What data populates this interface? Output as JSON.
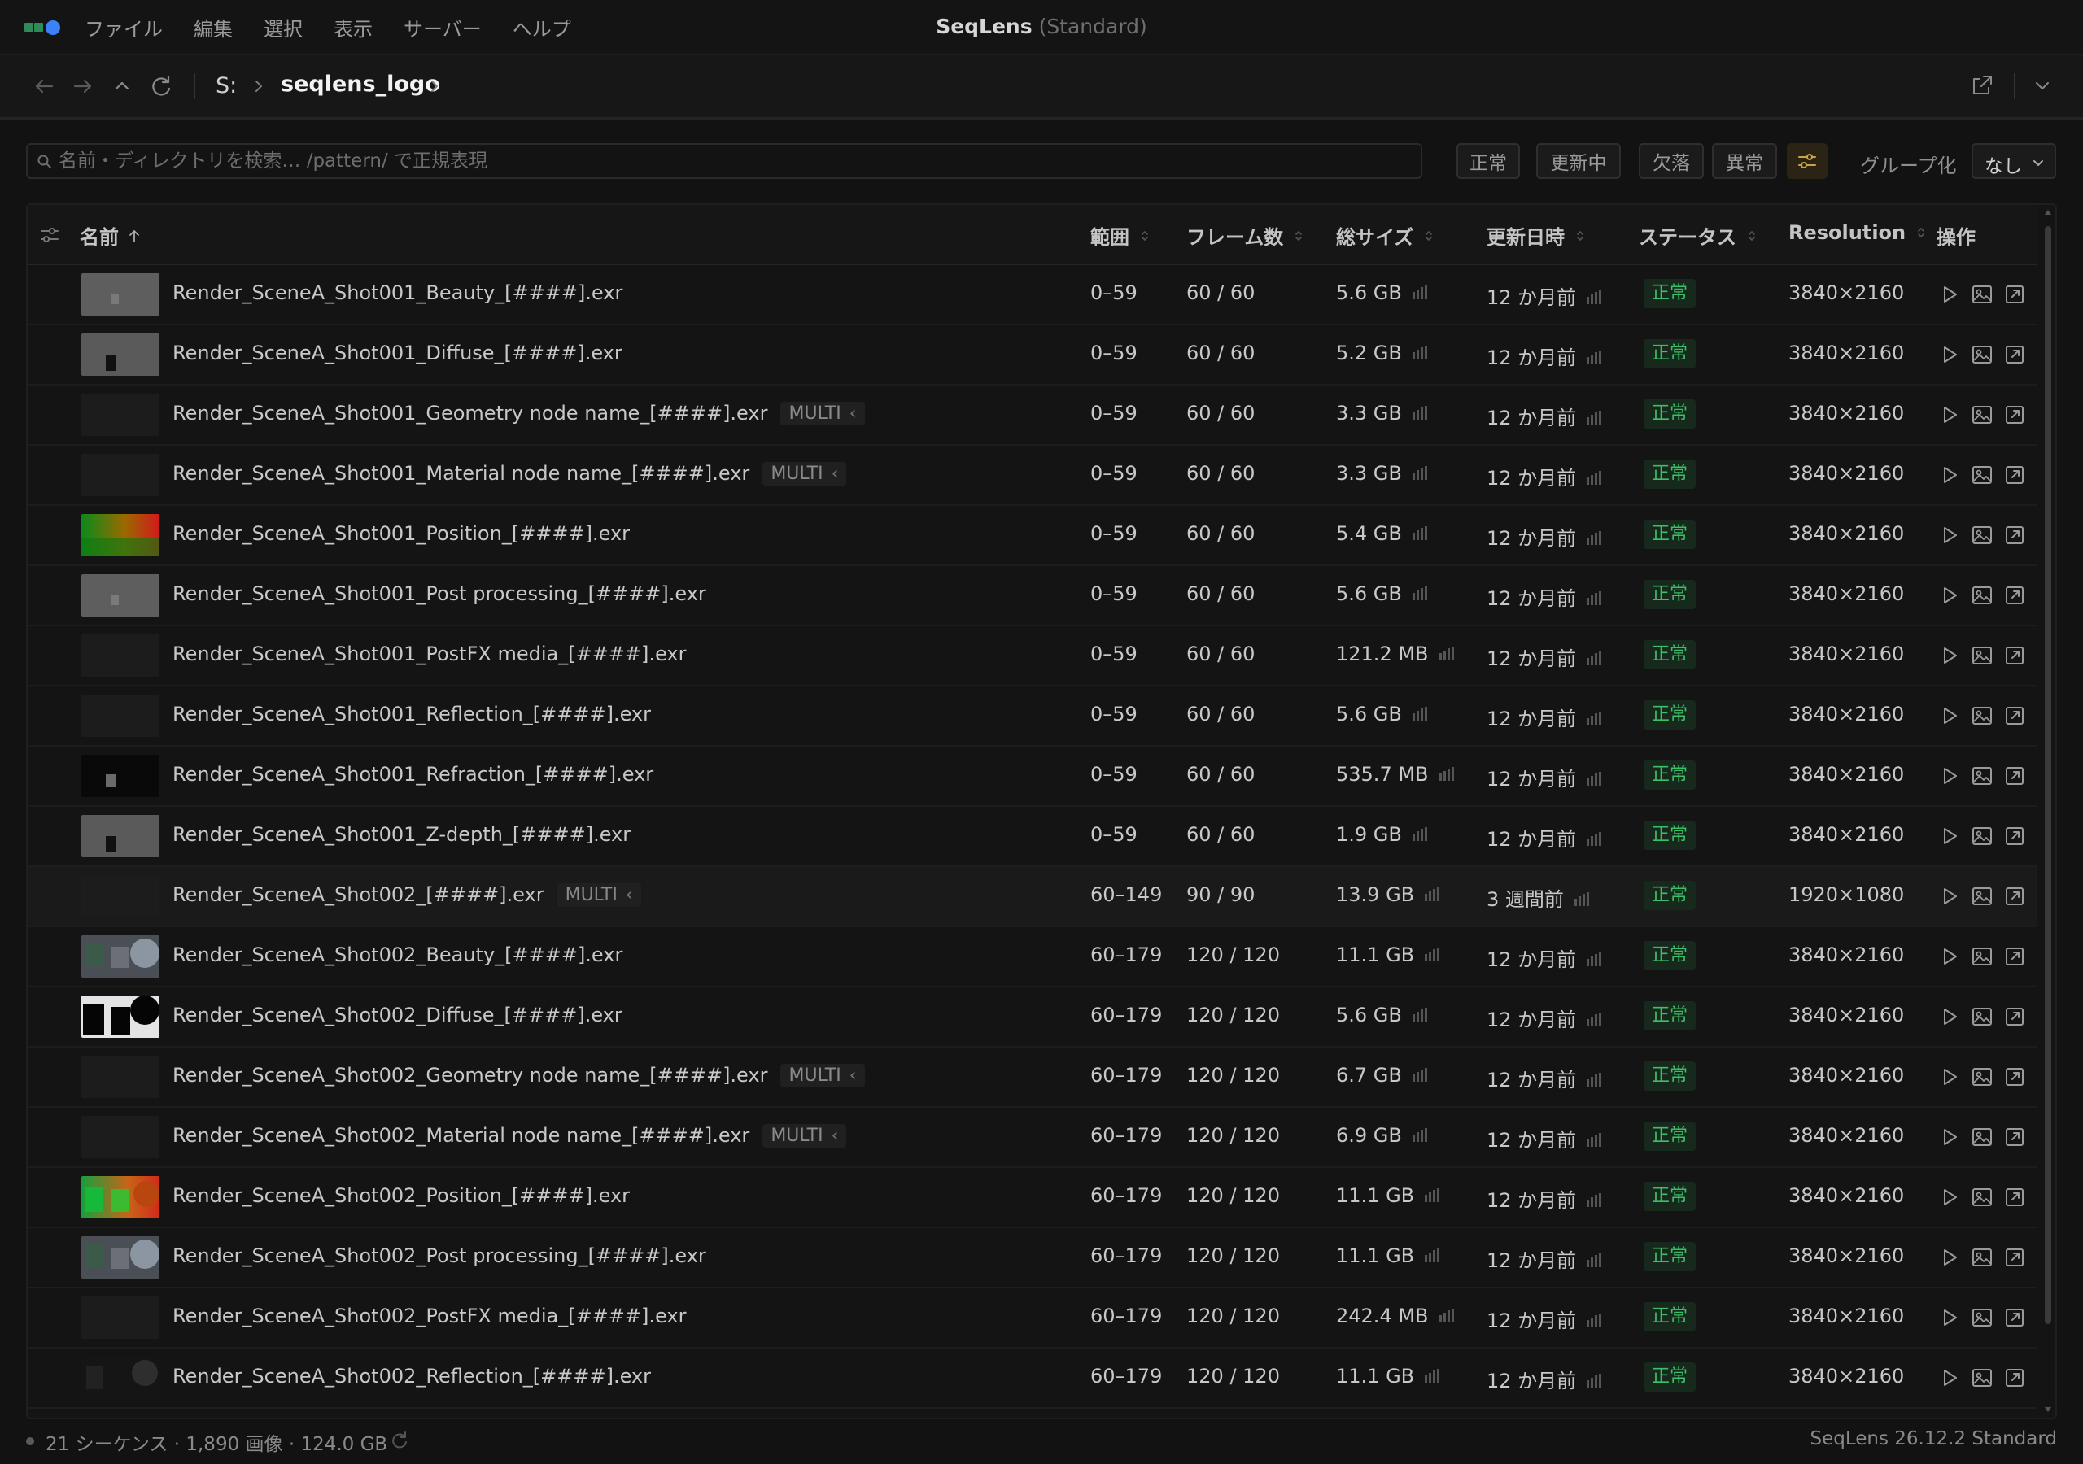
{
  "app": {
    "name": "SeqLens",
    "edition": "(Standard)"
  },
  "menu": [
    "ファイル",
    "編集",
    "選択",
    "表示",
    "サーバー",
    "ヘルプ"
  ],
  "path": {
    "drive": "S:",
    "folder": "seqlens_logo"
  },
  "search": {
    "placeholder": "名前・ディレクトリを検索… /pattern/ で正規表現",
    "value": ""
  },
  "filters": {
    "chips": [
      "正常",
      "更新中",
      "欠落",
      "異常"
    ],
    "group_label": "グループ化",
    "group_value": "なし"
  },
  "columns": {
    "name": "名前",
    "range": "範囲",
    "frames": "フレーム数",
    "size": "総サイズ",
    "modified": "更新日時",
    "status": "ステータス",
    "resolution": "Resolution",
    "actions": "操作"
  },
  "sort": {
    "column": "名前",
    "direction": "asc"
  },
  "rows": [
    {
      "name": "Render_SceneA_Shot001_Beauty_[####].exr",
      "badge": "",
      "range": "0–59",
      "frames": "60 / 60",
      "size": "5.6 GB",
      "modified": "12 か月前",
      "status": "正常",
      "resolution": "3840×2160",
      "thumb": "gray-object"
    },
    {
      "name": "Render_SceneA_Shot001_Diffuse_[####].exr",
      "badge": "",
      "range": "0–59",
      "frames": "60 / 60",
      "size": "5.2 GB",
      "modified": "12 か月前",
      "status": "正常",
      "resolution": "3840×2160",
      "thumb": "gray-block"
    },
    {
      "name": "Render_SceneA_Shot001_Geometry node name_[####].exr",
      "badge": "MULTI",
      "range": "0–59",
      "frames": "60 / 60",
      "size": "3.3 GB",
      "modified": "12 か月前",
      "status": "正常",
      "resolution": "3840×2160",
      "thumb": "dark"
    },
    {
      "name": "Render_SceneA_Shot001_Material node name_[####].exr",
      "badge": "MULTI",
      "range": "0–59",
      "frames": "60 / 60",
      "size": "3.3 GB",
      "modified": "12 か月前",
      "status": "正常",
      "resolution": "3840×2160",
      "thumb": "dark"
    },
    {
      "name": "Render_SceneA_Shot001_Position_[####].exr",
      "badge": "",
      "range": "0–59",
      "frames": "60 / 60",
      "size": "5.4 GB",
      "modified": "12 か月前",
      "status": "正常",
      "resolution": "3840×2160",
      "thumb": "position"
    },
    {
      "name": "Render_SceneA_Shot001_Post processing_[####].exr",
      "badge": "",
      "range": "0–59",
      "frames": "60 / 60",
      "size": "5.6 GB",
      "modified": "12 か月前",
      "status": "正常",
      "resolution": "3840×2160",
      "thumb": "gray-object"
    },
    {
      "name": "Render_SceneA_Shot001_PostFX media_[####].exr",
      "badge": "",
      "range": "0–59",
      "frames": "60 / 60",
      "size": "121.2 MB",
      "modified": "12 か月前",
      "status": "正常",
      "resolution": "3840×2160",
      "thumb": "dark"
    },
    {
      "name": "Render_SceneA_Shot001_Reflection_[####].exr",
      "badge": "",
      "range": "0–59",
      "frames": "60 / 60",
      "size": "5.6 GB",
      "modified": "12 か月前",
      "status": "正常",
      "resolution": "3840×2160",
      "thumb": "dark"
    },
    {
      "name": "Render_SceneA_Shot001_Refraction_[####].exr",
      "badge": "",
      "range": "0–59",
      "frames": "60 / 60",
      "size": "535.7 MB",
      "modified": "12 か月前",
      "status": "正常",
      "resolution": "3840×2160",
      "thumb": "black-object"
    },
    {
      "name": "Render_SceneA_Shot001_Z-depth_[####].exr",
      "badge": "",
      "range": "0–59",
      "frames": "60 / 60",
      "size": "1.9 GB",
      "modified": "12 か月前",
      "status": "正常",
      "resolution": "3840×2160",
      "thumb": "gray-block"
    },
    {
      "name": "Render_SceneA_Shot002_[####].exr",
      "badge": "MULTI",
      "range": "60–149",
      "frames": "90 / 90",
      "size": "13.9 GB",
      "modified": "3 週間前",
      "status": "正常",
      "resolution": "1920×1080",
      "thumb": "dark",
      "highlight": true
    },
    {
      "name": "Render_SceneA_Shot002_Beauty_[####].exr",
      "badge": "",
      "range": "60–179",
      "frames": "120 / 120",
      "size": "11.1 GB",
      "modified": "12 か月前",
      "status": "正常",
      "resolution": "3840×2160",
      "thumb": "spheres"
    },
    {
      "name": "Render_SceneA_Shot002_Diffuse_[####].exr",
      "badge": "",
      "range": "60–179",
      "frames": "120 / 120",
      "size": "5.6 GB",
      "modified": "12 か月前",
      "status": "正常",
      "resolution": "3840×2160",
      "thumb": "black-shapes"
    },
    {
      "name": "Render_SceneA_Shot002_Geometry node name_[####].exr",
      "badge": "MULTI",
      "range": "60–179",
      "frames": "120 / 120",
      "size": "6.7 GB",
      "modified": "12 か月前",
      "status": "正常",
      "resolution": "3840×2160",
      "thumb": "dark"
    },
    {
      "name": "Render_SceneA_Shot002_Material node name_[####].exr",
      "badge": "MULTI",
      "range": "60–179",
      "frames": "120 / 120",
      "size": "6.9 GB",
      "modified": "12 か月前",
      "status": "正常",
      "resolution": "3840×2160",
      "thumb": "dark"
    },
    {
      "name": "Render_SceneA_Shot002_Position_[####].exr",
      "badge": "",
      "range": "60–179",
      "frames": "120 / 120",
      "size": "11.1 GB",
      "modified": "12 か月前",
      "status": "正常",
      "resolution": "3840×2160",
      "thumb": "position2"
    },
    {
      "name": "Render_SceneA_Shot002_Post processing_[####].exr",
      "badge": "",
      "range": "60–179",
      "frames": "120 / 120",
      "size": "11.1 GB",
      "modified": "12 か月前",
      "status": "正常",
      "resolution": "3840×2160",
      "thumb": "spheres"
    },
    {
      "name": "Render_SceneA_Shot002_PostFX media_[####].exr",
      "badge": "",
      "range": "60–179",
      "frames": "120 / 120",
      "size": "242.4 MB",
      "modified": "12 か月前",
      "status": "正常",
      "resolution": "3840×2160",
      "thumb": "dark"
    },
    {
      "name": "Render_SceneA_Shot002_Reflection_[####].exr",
      "badge": "",
      "range": "60–179",
      "frames": "120 / 120",
      "size": "11.1 GB",
      "modified": "12 か月前",
      "status": "正常",
      "resolution": "3840×2160",
      "thumb": "dark-spheres"
    }
  ],
  "statusbar": {
    "summary": "21 シーケンス · 1,890 画像 · 124.0 GB",
    "version": "SeqLens 26.12.2 Standard"
  },
  "colors": {
    "accent": "#3b82f6",
    "ok_text": "#3cbf68",
    "ok_bg": "#17291c",
    "logo_green": "#2e8b57",
    "filter_active_bg": "#2b2415",
    "filter_active_icon": "#c9a24a"
  },
  "icons": {
    "nav": [
      "back-arrow-icon",
      "forward-arrow-icon",
      "up-arrow-icon",
      "refresh-icon"
    ],
    "row_actions": [
      "play-icon",
      "image-icon",
      "open-external-icon"
    ]
  }
}
